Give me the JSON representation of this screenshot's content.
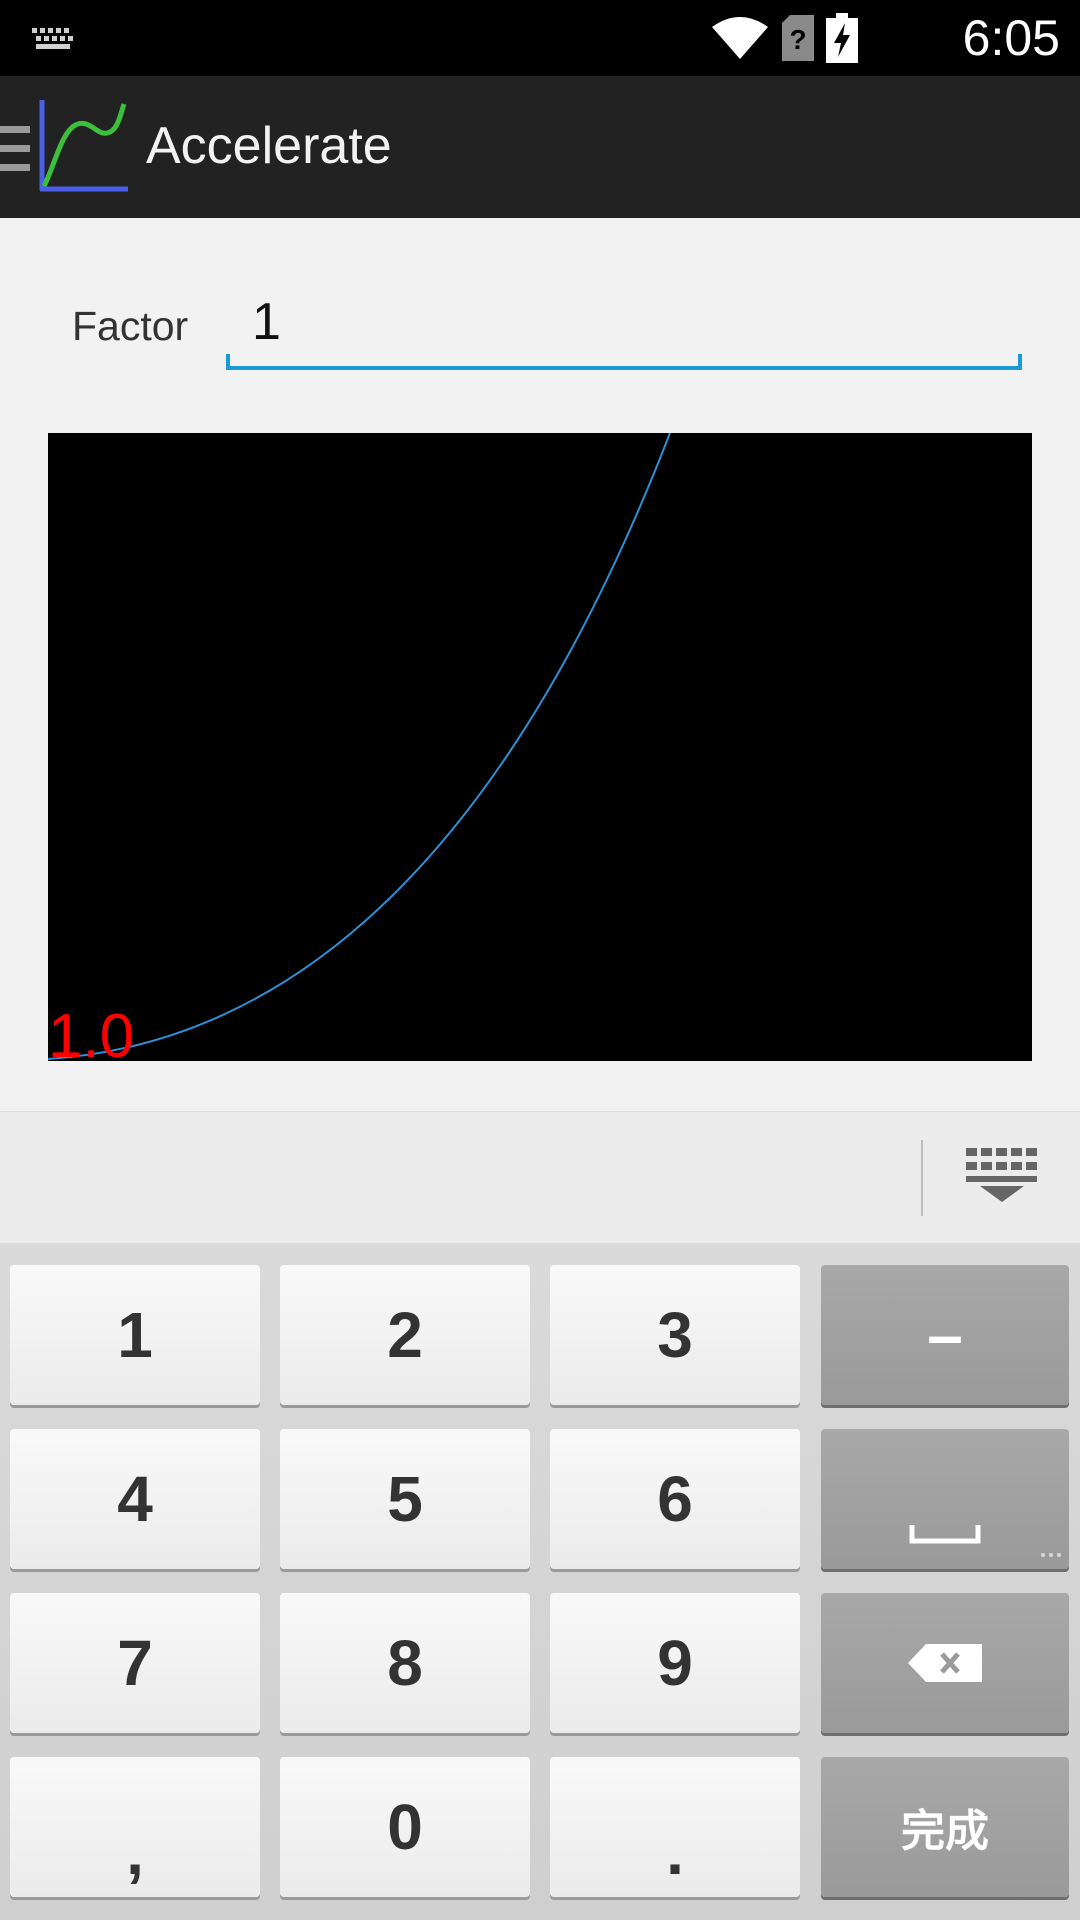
{
  "status_bar": {
    "time": "6:05",
    "icons": [
      "keyboard-icon",
      "wifi-icon",
      "no-sim-icon",
      "battery-charging-icon"
    ]
  },
  "action_bar": {
    "title": "Accelerate",
    "icons": [
      "drawer-icon",
      "app-logo-icon"
    ]
  },
  "form": {
    "factor_label": "Factor",
    "factor_value": "1"
  },
  "graph": {
    "label": "1.0",
    "curve_color": "#2d8fd6",
    "label_color": "#ff0000"
  },
  "keyboard": {
    "rows": [
      [
        "1",
        "2",
        "3",
        "–"
      ],
      [
        "4",
        "5",
        "6",
        "space"
      ],
      [
        "7",
        "8",
        "9",
        "backspace"
      ],
      [
        ",",
        "0",
        ".",
        "完成"
      ]
    ],
    "minus_label": "–",
    "comma_label": ",",
    "period_label": ".",
    "done_label": "完成"
  },
  "colors": {
    "accent": "#1a9bd7",
    "action_bar": "#222222"
  }
}
